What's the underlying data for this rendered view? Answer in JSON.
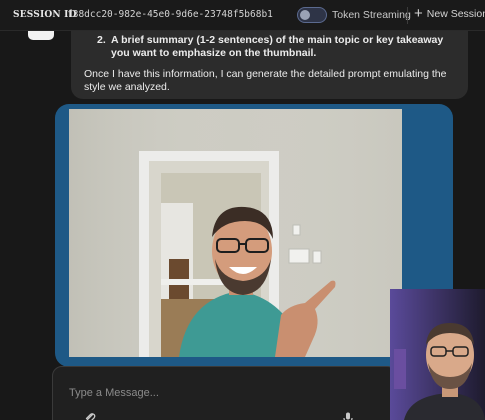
{
  "topbar": {
    "session_label": "SESSION ID",
    "session_id": "f38dcc20-982e-45e0-9d6e-23748f5b68b1",
    "toggle_label": "Token Streaming",
    "toggle_on": false,
    "new_session_label": "New Session"
  },
  "assistant_message": {
    "list_number": "2.",
    "list_text": "A brief summary (1-2 sentences) of the main topic or key takeaway you want to emphasize on the thumbnail.",
    "paragraph": "Once I have this information, I can generate the detailed prompt emulating the style we analyzed."
  },
  "composer": {
    "placeholder": "Type a Message...",
    "value": ""
  },
  "colors": {
    "background": "#181818",
    "assistant_bubble": "#2c2c2c",
    "user_bubble": "#1e5986",
    "accent_toggle_border": "#5b6a8f"
  },
  "icons": {
    "new_session": "plus-icon",
    "attach": "paperclip-icon",
    "mic": "microphone-icon"
  }
}
